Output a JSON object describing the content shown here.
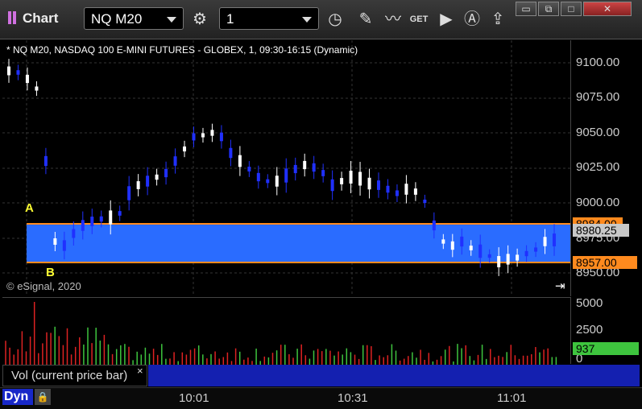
{
  "toolbar": {
    "title": "Chart",
    "symbol_value": "NQ M20",
    "interval_value": "1",
    "icons": [
      "settings-icon",
      "clock-icon",
      "pencil-icon",
      "study-icon",
      "get-icon",
      "play-icon",
      "alert-icon",
      "link-icon"
    ]
  },
  "chart": {
    "header": "* NQ M20, NASDAQ 100 E-MINI FUTURES - GLOBEX, 1, 09:30-16:15 (Dynamic)",
    "copyright": "© eSignal, 2020",
    "marker_a": "A",
    "marker_b": "B",
    "colors": {
      "up": "#ffffff",
      "down": "#2030ff",
      "band": "#2a6cff",
      "level": "#ff8a1e"
    }
  },
  "price_axis": {
    "labels": [
      "9100.00",
      "9075.00",
      "9050.00",
      "9025.00",
      "9000.00",
      "8975.00",
      "8950.00"
    ],
    "tag_high": "8984.00",
    "tag_last": "8980.25",
    "tag_low": "8957.00"
  },
  "volume": {
    "legend": "Vol (current price bar)",
    "close": "×",
    "labels": [
      "5000",
      "2500",
      "0"
    ],
    "last": "937"
  },
  "time_axis": {
    "labels": [
      "10:01",
      "10:31",
      "11:01"
    ],
    "mode": "Dyn"
  }
}
